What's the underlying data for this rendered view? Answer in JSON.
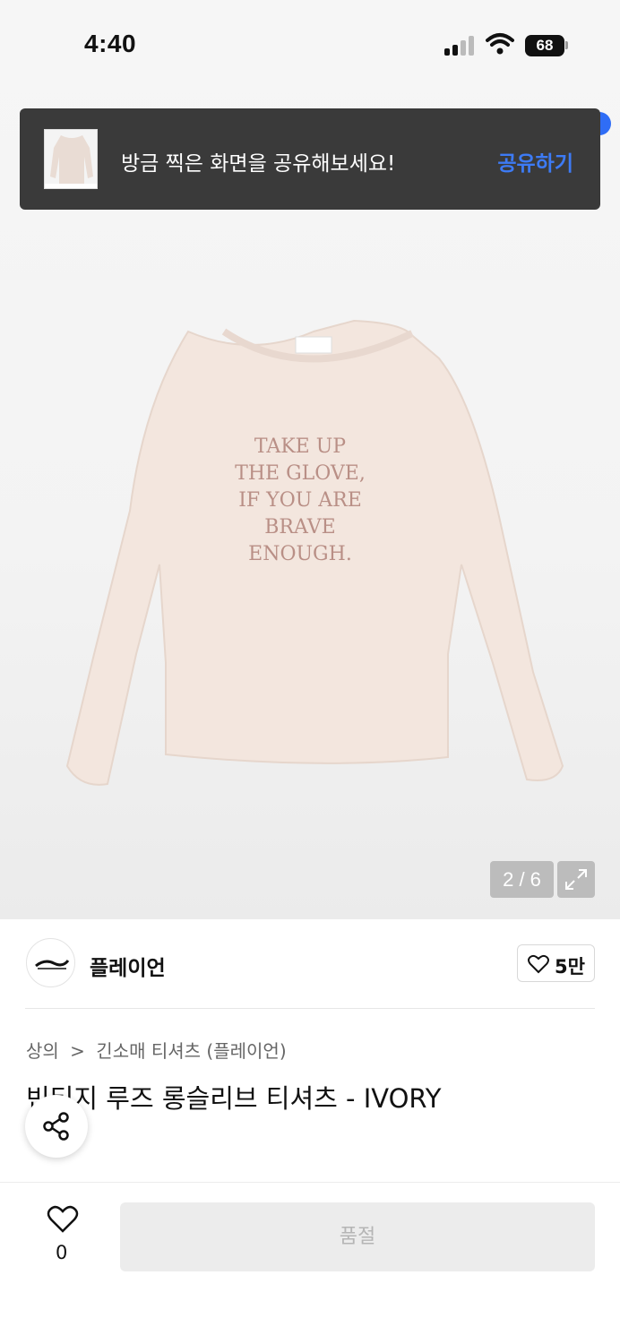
{
  "status_bar": {
    "time": "4:40",
    "battery": "68"
  },
  "toast": {
    "message": "방금 찍은 화면을 공유해보세요!",
    "action_label": "공유하기"
  },
  "gallery": {
    "counter": "2 / 6",
    "product_print": [
      "TAKE UP",
      "THE GLOVE,",
      "IF YOU ARE",
      "BRAVE",
      "ENOUGH."
    ]
  },
  "brand": {
    "name": "플레이언",
    "likes": "5만"
  },
  "breadcrumb": {
    "level1": "상의",
    "separator": ">",
    "level2": "긴소매 티셔츠 (플레이언)"
  },
  "product": {
    "title": "빈티지 루즈 롱슬리브 티셔츠 - IVORY"
  },
  "bottom_bar": {
    "wish_count": "0",
    "buy_label": "품절"
  },
  "colors": {
    "accent_blue": "#3d7bf5",
    "toast_bg": "#3a3a3a",
    "shirt": "#f3e6de",
    "print": "#b98f86"
  },
  "icons": [
    "signal-icon",
    "wifi-icon",
    "battery-icon",
    "expand-icon",
    "heart-icon",
    "share-icon"
  ]
}
